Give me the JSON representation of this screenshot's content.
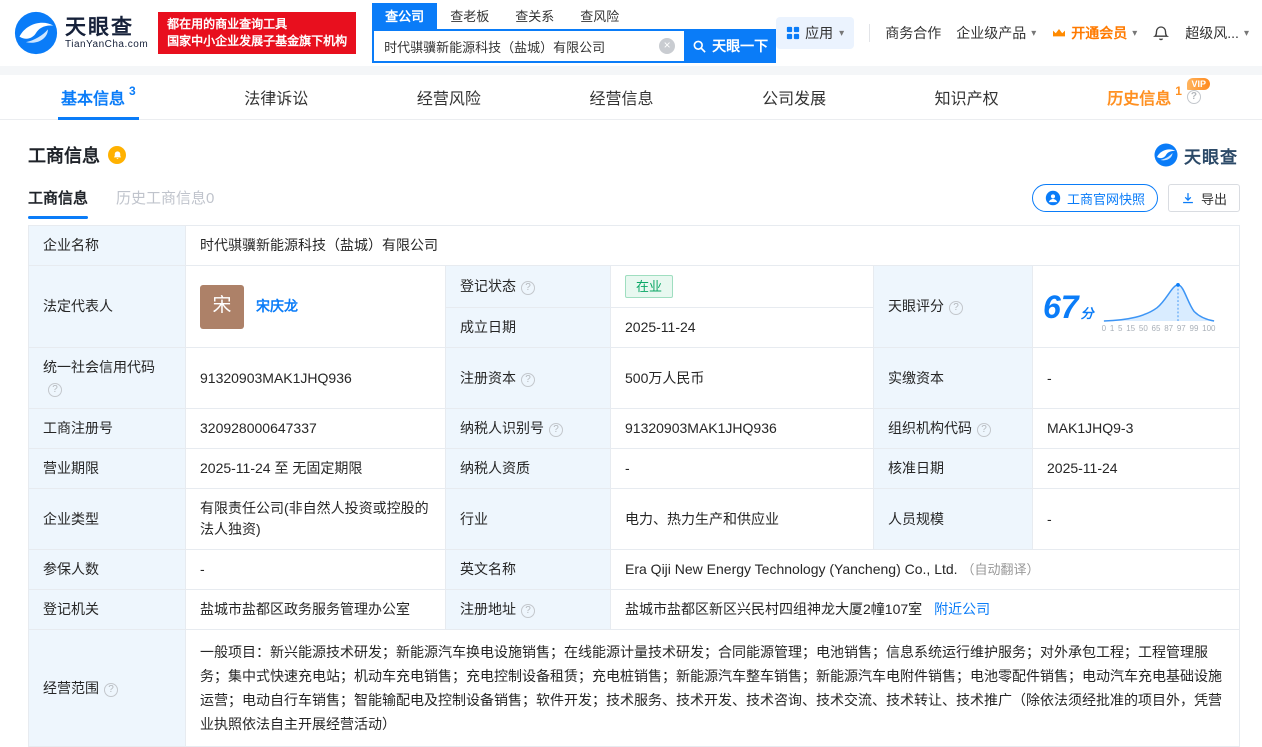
{
  "brand": {
    "name": "天眼查",
    "domain": "TianYanCha.com",
    "blue": "#0a7cf8"
  },
  "header": {
    "slogan_line1": "都在用的商业查询工具",
    "slogan_line2": "国家中小企业发展子基金旗下机构",
    "search_tabs": [
      {
        "label": "查公司"
      },
      {
        "label": "查老板"
      },
      {
        "label": "查关系"
      },
      {
        "label": "查风险"
      }
    ],
    "search": {
      "value": "时代骐骥新能源科技（盐城）有限公司",
      "button": "天眼一下"
    },
    "right_menu": {
      "apps": "应用",
      "cooperation": "商务合作",
      "enterprise": "企业级产品",
      "vip": "开通会员",
      "risk": "超级风..."
    }
  },
  "nav_tabs": [
    {
      "label": "基本信息",
      "count": "3"
    },
    {
      "label": "法律诉讼",
      "count": ""
    },
    {
      "label": "经营风险",
      "count": ""
    },
    {
      "label": "经营信息",
      "count": ""
    },
    {
      "label": "公司发展",
      "count": ""
    },
    {
      "label": "知识产权",
      "count": ""
    },
    {
      "label": "历史信息",
      "count": "1",
      "badge": "VIP"
    }
  ],
  "section": {
    "title": "工商信息",
    "subtabs": [
      {
        "label": "工商信息"
      },
      {
        "label": "历史工商信息0"
      }
    ],
    "snapshot_button": "工商官网快照",
    "export_button": "导出"
  },
  "info": {
    "company_name": {
      "label": "企业名称",
      "value": "时代骐骥新能源科技（盐城）有限公司"
    },
    "legal_rep": {
      "label": "法定代表人",
      "avatar": "宋",
      "name": "宋庆龙"
    },
    "reg_status": {
      "label": "登记状态",
      "value": "在业"
    },
    "establish_date": {
      "label": "成立日期",
      "value": "2025-11-24"
    },
    "score": {
      "label": "天眼评分",
      "value": "67",
      "unit": "分",
      "axis_labels": [
        "0",
        "1",
        "5",
        "15",
        "50",
        "65",
        "87",
        "97",
        "99",
        "100"
      ]
    },
    "credit_code": {
      "label": "统一社会信用代码",
      "value": "91320903MAK1JHQ936"
    },
    "reg_capital": {
      "label": "注册资本",
      "value": "500万人民币"
    },
    "paid_capital": {
      "label": "实缴资本",
      "value": "-"
    },
    "reg_number": {
      "label": "工商注册号",
      "value": "320928000647337"
    },
    "taxpayer_id": {
      "label": "纳税人识别号",
      "value": "91320903MAK1JHQ936"
    },
    "org_code": {
      "label": "组织机构代码",
      "value": "MAK1JHQ9-3"
    },
    "business_term": {
      "label": "营业期限",
      "value": "2025-11-24 至 无固定期限"
    },
    "taxpayer_quality": {
      "label": "纳税人资质",
      "value": "-"
    },
    "approval_date": {
      "label": "核准日期",
      "value": "2025-11-24"
    },
    "company_type": {
      "label": "企业类型",
      "value": "有限责任公司(非自然人投资或控股的法人独资)"
    },
    "industry": {
      "label": "行业",
      "value": "电力、热力生产和供应业"
    },
    "staff_size": {
      "label": "人员规模",
      "value": "-"
    },
    "insured_count": {
      "label": "参保人数",
      "value": "-"
    },
    "english_name": {
      "label": "英文名称",
      "value": "Era Qiji New Energy Technology (Yancheng) Co., Ltd.",
      "note": "（自动翻译）"
    },
    "reg_authority": {
      "label": "登记机关",
      "value": "盐城市盐都区政务服务管理办公室"
    },
    "address": {
      "label": "注册地址",
      "value": "盐城市盐都区新区兴民村四组神龙大厦2幢107室",
      "link": "附近公司"
    },
    "business_scope": {
      "label": "经营范围",
      "value": "一般项目：新兴能源技术研发；新能源汽车换电设施销售；在线能源计量技术研发；合同能源管理；电池销售；信息系统运行维护服务；对外承包工程；工程管理服务；集中式快速充电站；机动车充电销售；充电控制设备租赁；充电桩销售；新能源汽车整车销售；新能源汽车电附件销售；电池零配件销售；电动汽车充电基础设施运营；电动自行车销售；智能输配电及控制设备销售；软件开发；技术服务、技术开发、技术咨询、技术交流、技术转让、技术推广（除依法须经批准的项目外，凭营业执照依法自主开展经营活动）"
    }
  }
}
